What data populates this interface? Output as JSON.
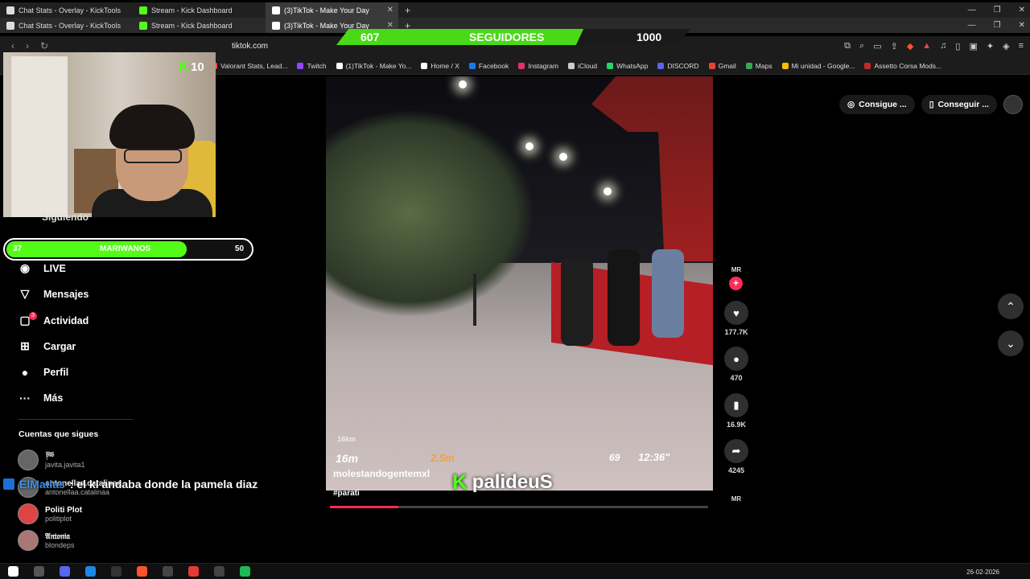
{
  "browser_tabs_row1": [
    {
      "label": "Chat Stats - Overlay - KickTools",
      "icon_color": "#dddddd"
    },
    {
      "label": "Stream - Kick Dashboard",
      "icon_color": "#53fc18"
    },
    {
      "label": "(3)TikTok - Make Your Day",
      "icon_color": "#ffffff",
      "active": true
    }
  ],
  "browser_tabs_row2": [
    {
      "label": "Chat Stats - Overlay - KickTools",
      "icon_color": "#dddddd"
    },
    {
      "label": "Stream - Kick Dashboard",
      "icon_color": "#53fc18"
    },
    {
      "label": "(3)TikTok - Make Your Day",
      "icon_color": "#ffffff",
      "active": true
    }
  ],
  "address": {
    "url": "tiktok.com"
  },
  "bookmarks": [
    {
      "label": "Valorant Stats, Lead...",
      "color": "#ff4655"
    },
    {
      "label": "Twitch",
      "color": "#9146ff"
    },
    {
      "label": "(1)TikTok - Make Yo...",
      "color": "#ffffff"
    },
    {
      "label": "Home / X",
      "color": "#ffffff"
    },
    {
      "label": "Facebook",
      "color": "#1877f2"
    },
    {
      "label": "Instagram",
      "color": "#e1306c"
    },
    {
      "label": "iCloud",
      "color": "#cccccc"
    },
    {
      "label": "WhatsApp",
      "color": "#25d366"
    },
    {
      "label": "DISCORD",
      "color": "#5865f2"
    },
    {
      "label": "Gmail",
      "color": "#ea4335"
    },
    {
      "label": "Maps",
      "color": "#34a853"
    },
    {
      "label": "Mi unidad - Google...",
      "color": "#fbbc04"
    },
    {
      "label": "Assetto Corsa Mods...",
      "color": "#c62828"
    }
  ],
  "followers_goal": {
    "current": "607",
    "label": "SEGUIDORES",
    "target": "1000",
    "progress": 0.607
  },
  "kick_badge": {
    "icon": "K",
    "count": "10"
  },
  "sidebar": {
    "siguiendo": "Siguiendo",
    "items": [
      {
        "label": "LIVE",
        "icon": "live-icon"
      },
      {
        "label": "Mensajes",
        "icon": "send-icon"
      },
      {
        "label": "Actividad",
        "icon": "activity-icon",
        "badge": "3"
      },
      {
        "label": "Cargar",
        "icon": "upload-icon"
      },
      {
        "label": "Perfil",
        "icon": "profile-icon"
      },
      {
        "label": "Más",
        "icon": "more-icon"
      }
    ],
    "following_header": "Cuentas que sigues",
    "accounts": [
      {
        "name": "🏁",
        "handle": "javita.javita1"
      },
      {
        "name": "antonellaa.catalinaa",
        "handle": "antonellaa.catalinaa"
      },
      {
        "name": "Politi Plot",
        "handle": "politiplot"
      },
      {
        "name": "𝔄𝔫𝔱𝔬𝔫𝔦𝔞",
        "handle": "blondeps"
      }
    ]
  },
  "sub_goal": {
    "left": "37",
    "label": "MARIWANOS",
    "right": "50",
    "progress": 0.74
  },
  "chat": {
    "user": "ElMatias",
    "message": ": el kl andaba donde la pamela diaz"
  },
  "video": {
    "hud_distance": "16m",
    "hud_small": "16km",
    "hud_height": "2.5m",
    "hud_speed": "69",
    "hud_time": "12:36\"",
    "author": "molestandogentemxl",
    "caption": "#parati",
    "progress": 0.18
  },
  "streamer_overlay": {
    "icon": "K",
    "name": "palideuS"
  },
  "actions": {
    "creator_tag": "MR",
    "likes": "177.7K",
    "comments": "470",
    "saves": "16.9K",
    "shares": "4245"
  },
  "top_pills": {
    "coins": "Consigue ...",
    "app": "Conseguir ..."
  },
  "taskbar": {
    "date": "26-02-2026"
  }
}
